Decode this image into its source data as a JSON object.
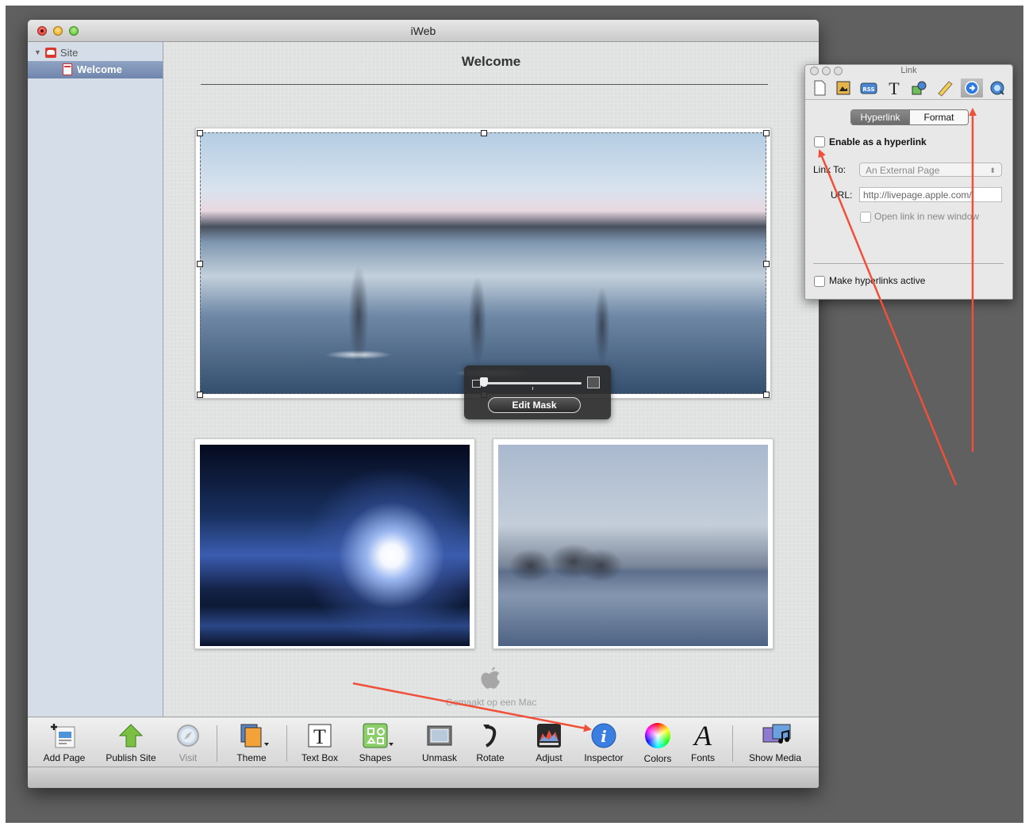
{
  "window": {
    "title": "iWeb"
  },
  "sidebar": {
    "site_label": "Site",
    "pages": [
      {
        "label": "Welcome",
        "selected": true
      }
    ]
  },
  "canvas": {
    "page_title": "Welcome",
    "footer_text": "Gemaakt op een Mac"
  },
  "mask_hud": {
    "button_label": "Edit Mask"
  },
  "toolbar": {
    "items": [
      {
        "label": "Add Page",
        "icon": "add-page-icon"
      },
      {
        "label": "Publish Site",
        "icon": "publish-arrow-icon"
      },
      {
        "label": "Visit",
        "icon": "compass-icon",
        "disabled": true
      },
      {
        "label": "Theme",
        "icon": "theme-icon"
      },
      {
        "label": "Text Box",
        "icon": "text-box-icon"
      },
      {
        "label": "Shapes",
        "icon": "shapes-icon"
      },
      {
        "label": "Unmask",
        "icon": "unmask-icon"
      },
      {
        "label": "Rotate",
        "icon": "rotate-icon"
      },
      {
        "label": "Adjust",
        "icon": "adjust-icon"
      },
      {
        "label": "Inspector",
        "icon": "info-icon"
      },
      {
        "label": "Colors",
        "icon": "color-wheel-icon"
      },
      {
        "label": "Fonts",
        "icon": "fonts-icon"
      },
      {
        "label": "Show Media",
        "icon": "media-icon"
      }
    ]
  },
  "inspector": {
    "title": "Link",
    "tabs": [
      "Hyperlink",
      "Format"
    ],
    "active_tab": "Hyperlink",
    "enable_hyperlink_label": "Enable as a hyperlink",
    "enable_hyperlink_checked": false,
    "link_to_label": "Link To:",
    "link_to_value": "An External Page",
    "url_label": "URL:",
    "url_value": "http://livepage.apple.com/",
    "open_new_window_label": "Open link in new window",
    "make_active_label": "Make hyperlinks active",
    "make_active_checked": false,
    "tool_icons": [
      "document-icon",
      "layout-icon",
      "rss-icon",
      "text-icon",
      "graphic-icon",
      "ruler-icon",
      "link-icon",
      "quicktime-icon"
    ],
    "active_tool": "link-icon"
  },
  "colors": {
    "annotation_arrow": "#f0503a",
    "selection": "#6f86ad"
  }
}
